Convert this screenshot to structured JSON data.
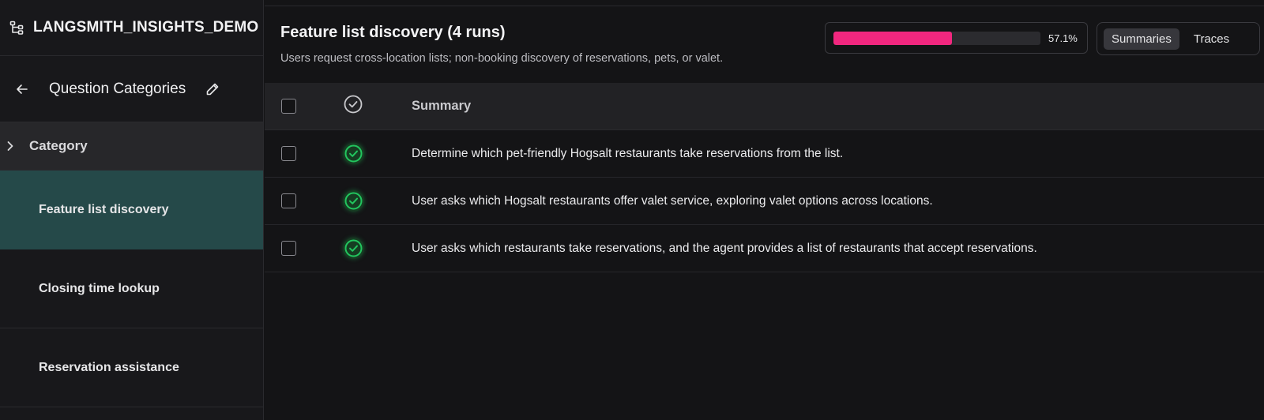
{
  "sidebar": {
    "project_title": "LANGSMITH_INSIGHTS_DEMO",
    "page_title": "Question Categories",
    "group_label": "Category",
    "items": [
      {
        "label": "Feature list discovery",
        "active": true
      },
      {
        "label": "Closing time lookup",
        "active": false
      },
      {
        "label": "Reservation assistance",
        "active": false
      }
    ]
  },
  "main": {
    "title": "Feature list discovery (4 runs)",
    "subtitle": "Users request cross-location lists; non-booking discovery of reservations, pets, or valet.",
    "progress": {
      "value": 0.571,
      "label": "57.1%",
      "color": "#f2277f"
    },
    "view_toggle": {
      "options": [
        "Summaries",
        "Traces"
      ],
      "selected": "Summaries"
    },
    "table": {
      "header": {
        "summary": "Summary"
      },
      "rows": [
        {
          "status": "success",
          "summary": "Determine which pet-friendly Hogsalt restaurants take reservations from the list."
        },
        {
          "status": "success",
          "summary": "User asks which Hogsalt restaurants offer valet service, exploring valet options across locations."
        },
        {
          "status": "success",
          "summary": "User asks which restaurants take reservations, and the agent provides a list of restaurants that accept reservations."
        }
      ]
    }
  },
  "colors": {
    "accent_active": "#254949",
    "progress": "#f2277f",
    "success": "#22c55e"
  },
  "icons": {
    "project": "tree-icon",
    "back": "arrow-left-icon",
    "edit": "pencil-icon",
    "group": "chevron-right-icon",
    "header_status": "check-circle-icon",
    "row_status": "check-circle-success-icon"
  }
}
